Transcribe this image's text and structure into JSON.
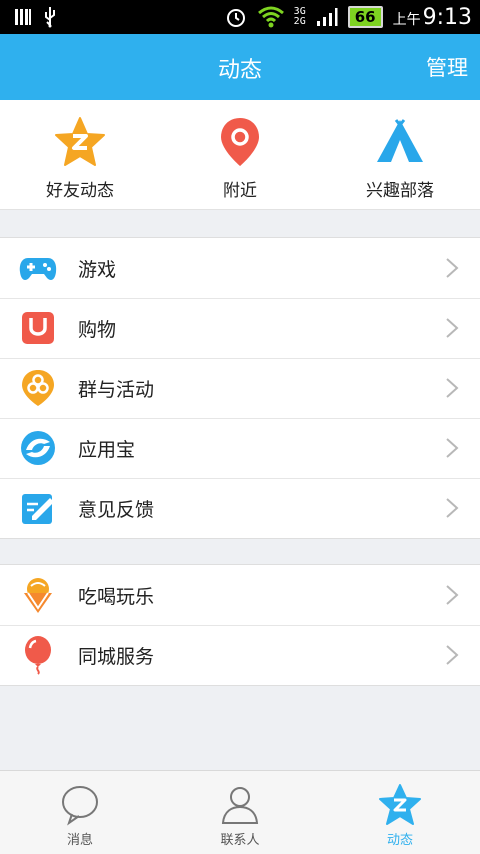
{
  "status_bar": {
    "network_top": "3G",
    "network_bottom": "2G",
    "battery": "66",
    "ampm": "上午",
    "time": "9:13"
  },
  "header": {
    "title": "动态",
    "manage_label": "管理"
  },
  "quick_actions": [
    {
      "label": "好友动态",
      "icon": "star-icon"
    },
    {
      "label": "附近",
      "icon": "location-pin-icon"
    },
    {
      "label": "兴趣部落",
      "icon": "tent-icon"
    }
  ],
  "list_group_1": [
    {
      "label": "游戏",
      "icon": "gamepad-icon"
    },
    {
      "label": "购物",
      "icon": "shopping-bag-icon"
    },
    {
      "label": "群与活动",
      "icon": "group-activity-icon"
    },
    {
      "label": "应用宝",
      "icon": "app-store-icon"
    },
    {
      "label": "意见反馈",
      "icon": "feedback-icon"
    }
  ],
  "list_group_2": [
    {
      "label": "吃喝玩乐",
      "icon": "ice-cream-icon"
    },
    {
      "label": "同城服务",
      "icon": "balloon-icon"
    }
  ],
  "tab_bar": [
    {
      "label": "消息",
      "icon": "message-bubble-icon"
    },
    {
      "label": "联系人",
      "icon": "contacts-icon"
    },
    {
      "label": "动态",
      "icon": "star-tab-icon"
    }
  ],
  "colors": {
    "header": "#2fb0ee",
    "star": "#f5a623",
    "pin": "#f05a4a",
    "tent": "#29a7ea"
  }
}
